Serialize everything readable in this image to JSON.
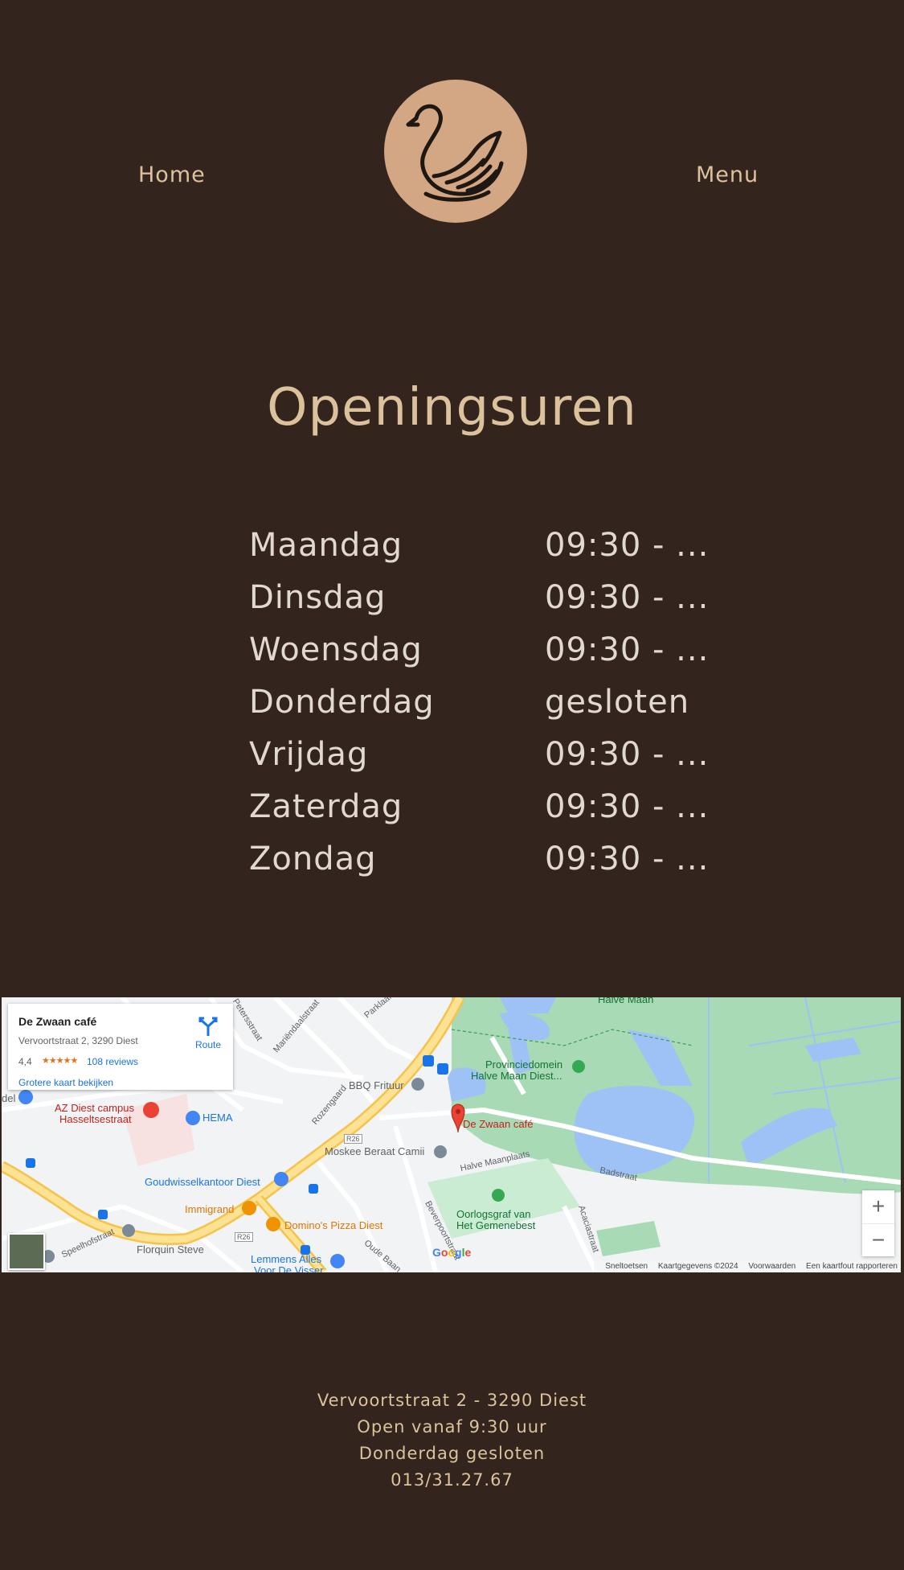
{
  "nav": {
    "home_label": "Home",
    "menu_label": "Menu",
    "logo_icon": "swan-icon"
  },
  "heading": "Openingsuren",
  "hours": [
    {
      "day": "Maandag",
      "time": "09:30 - ..."
    },
    {
      "day": "Dinsdag",
      "time": "09:30 - ..."
    },
    {
      "day": "Woensdag",
      "time": "09:30 - ..."
    },
    {
      "day": "Donderdag",
      "time": "gesloten"
    },
    {
      "day": "Vrijdag",
      "time": "09:30 - ..."
    },
    {
      "day": "Zaterdag",
      "time": "09:30 - ..."
    },
    {
      "day": "Zondag",
      "time": "09:30 - ..."
    }
  ],
  "map": {
    "card": {
      "name": "De Zwaan café",
      "address": "Vervoortstraat 2, 3290 Diest",
      "rating": "4,4",
      "stars": "★★★★★",
      "reviews": "108 reviews",
      "larger_map": "Grotere kaart bekijken",
      "route_label": "Route"
    },
    "labels": {
      "pin": "De Zwaan café",
      "park": "Provinciedomein Halve Maan Diest...",
      "park_line1": "Provinciedomein",
      "park_line2": "Halve Maan Diest...",
      "halve_maan": "Halve Maan",
      "bbq": "BBQ Frituur",
      "az_line1": "AZ Diest campus",
      "az_line2": "Hasseltsestraat",
      "hema": "HEMA",
      "moskee": "Moskee Beraat Camii",
      "halve_maanplaats": "Halve Maanplaats",
      "badstraat": "Badstraat",
      "goudwissel": "Goudwisselkantoor Diest",
      "immigrand": "Immigrand",
      "dominos": "Domino's Pizza Diest",
      "oorlog_line1": "Oorlogsgraf van",
      "oorlog_line2": "Het Gemenebest",
      "florquin": "Florquin Steve",
      "lemmens_line1": "Lemmens Alles",
      "lemmens_line2": "Voor De Visser",
      "speelhof": "Speelhofstraat",
      "rozengaard": "Rozengaard",
      "peters": "Petersstraat",
      "mariendaal": "Mariëndaalstraat",
      "parklaan": "Parklaan",
      "bever": "Beverpoortstraat",
      "acacia": "Acaciastraat",
      "oude_baan": "Oude Baan",
      "r26a": "R26",
      "r26b": "R26",
      "del": "del"
    },
    "google": "Google",
    "footer": {
      "keys": "Sneltoetsen",
      "data": "Kaartgegevens ©2024",
      "terms": "Voorwaarden",
      "report": "Een kaartfout rapporteren"
    },
    "zoom_in": "+",
    "zoom_out": "−"
  },
  "footer": {
    "address": "Vervoortstraat 2 - 3290 Diest",
    "open": "Open vanaf 9:30 uur",
    "closed": "Donderdag gesloten",
    "phone": "013/31.27.67"
  },
  "colors": {
    "background": "#33241e",
    "accent": "#dcc29c",
    "logo": "#d3a783",
    "text": "#e2d8d2"
  }
}
